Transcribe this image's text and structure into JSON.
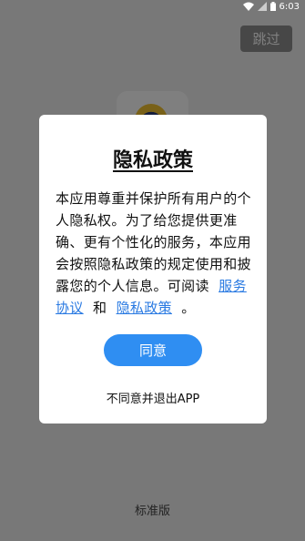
{
  "status_bar": {
    "time": "6:03"
  },
  "splash": {
    "skip_label": "跳过",
    "edition_label": "标准版"
  },
  "dialog": {
    "title": "隐私政策",
    "body_text": "本应用尊重并保护所有用户的个人隐私权。为了给您提供更准确、更有个性化的服务，本应用会按照隐私政策的规定使用和披露您的个人信息。可阅读",
    "link_service": "服务协议",
    "and_text": "和",
    "link_privacy": "隐私政策",
    "end_punct": "。",
    "agree_label": "同意",
    "disagree_label": "不同意并退出APP"
  },
  "colors": {
    "accent": "#2f8ef2",
    "link": "#2a7ae2",
    "skip_bg": "#8f8f8f"
  }
}
